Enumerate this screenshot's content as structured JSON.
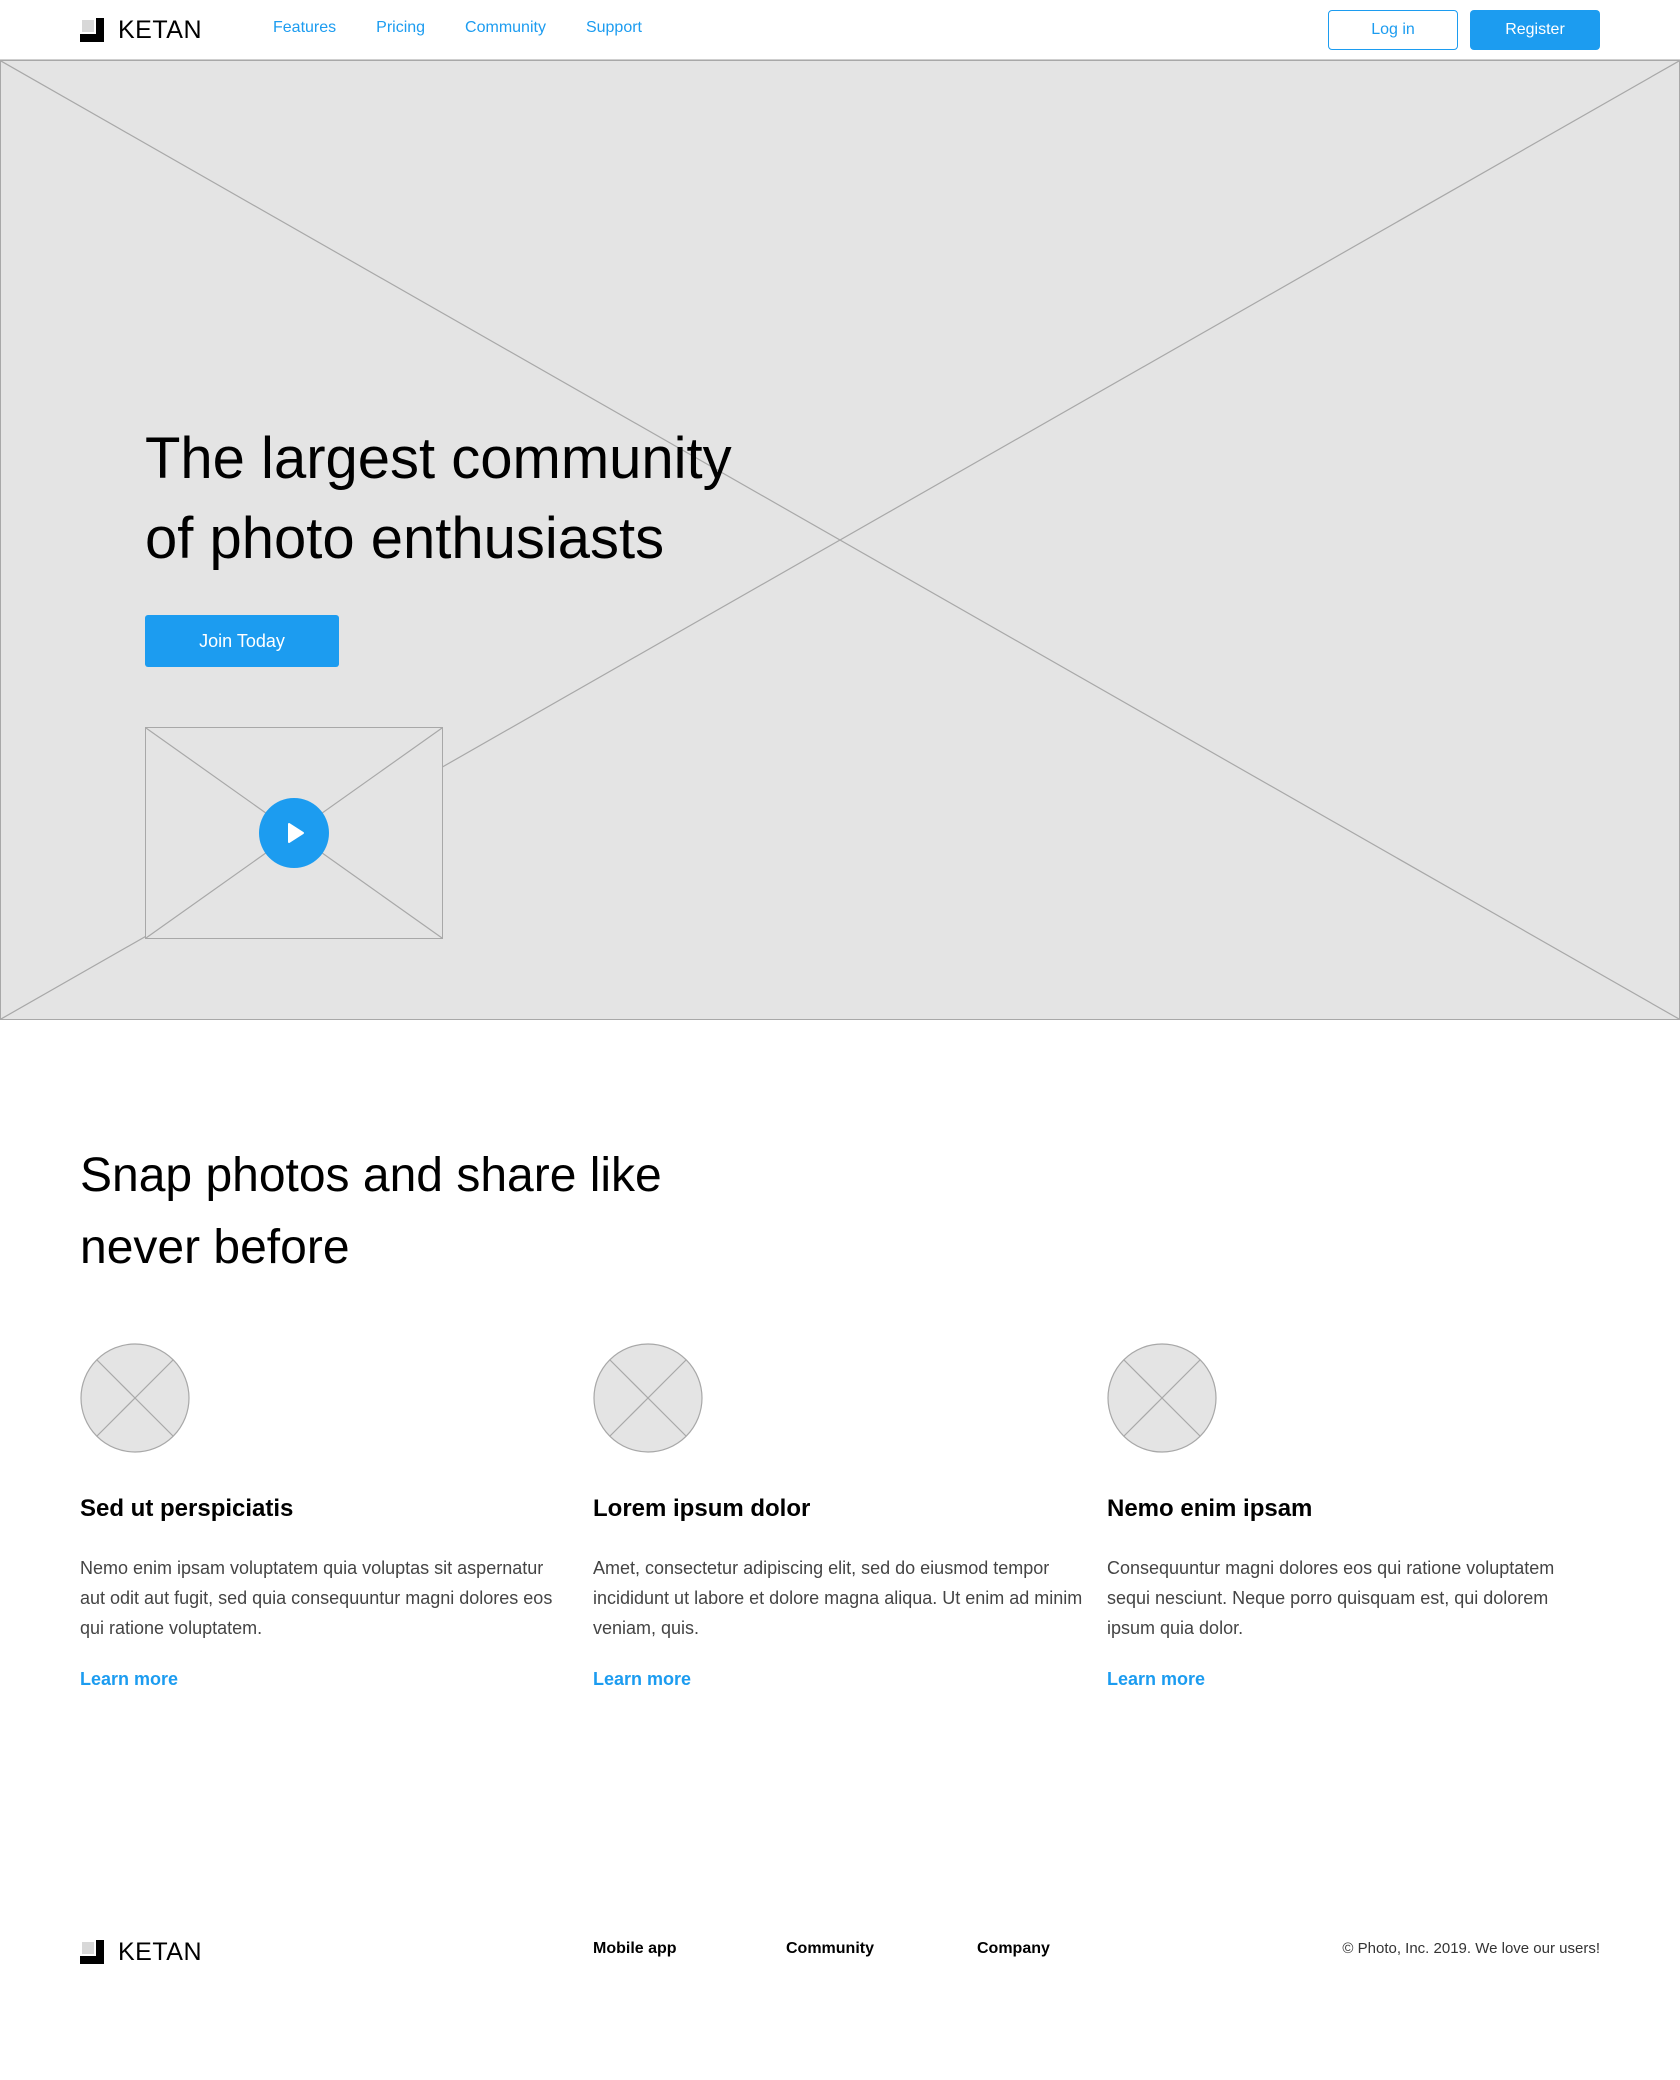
{
  "colors": {
    "accent": "#1c9cf0",
    "placeholder_bg": "#e4e4e4",
    "placeholder_line": "#a8a8a8"
  },
  "header": {
    "logo_text": "KETAN",
    "nav": [
      "Features",
      "Pricing",
      "Community",
      "Support"
    ],
    "login_label": "Log in",
    "register_label": "Register"
  },
  "hero": {
    "title_line1": "The largest community",
    "title_line2": "of photo enthusiasts",
    "cta_label": "Join Today",
    "video_icon": "play-icon"
  },
  "features": {
    "title_line1": "Snap photos and share like",
    "title_line2": "never before",
    "items": [
      {
        "heading": "Sed ut perspiciatis",
        "text": "Nemo enim ipsam voluptatem quia voluptas sit aspernatur aut odit aut fugit, sed quia consequuntur magni dolores eos qui ratione voluptatem.",
        "link": "Learn more"
      },
      {
        "heading": "Lorem ipsum dolor",
        "text": "Amet, consectetur adipiscing elit, sed do eiusmod tempor incididunt ut labore et dolore magna aliqua. Ut enim ad minim veniam, quis.",
        "link": "Learn more"
      },
      {
        "heading": "Nemo enim ipsam",
        "text": "Consequuntur magni dolores eos qui ratione voluptatem sequi nesciunt. Neque porro quisquam est, qui dolorem ipsum quia dolor.",
        "link": "Learn more"
      }
    ]
  },
  "footer": {
    "logo_text": "KETAN",
    "links": [
      "Mobile app",
      "Community",
      "Company"
    ],
    "copyright": "© Photo, Inc. 2019. We love our users!"
  }
}
